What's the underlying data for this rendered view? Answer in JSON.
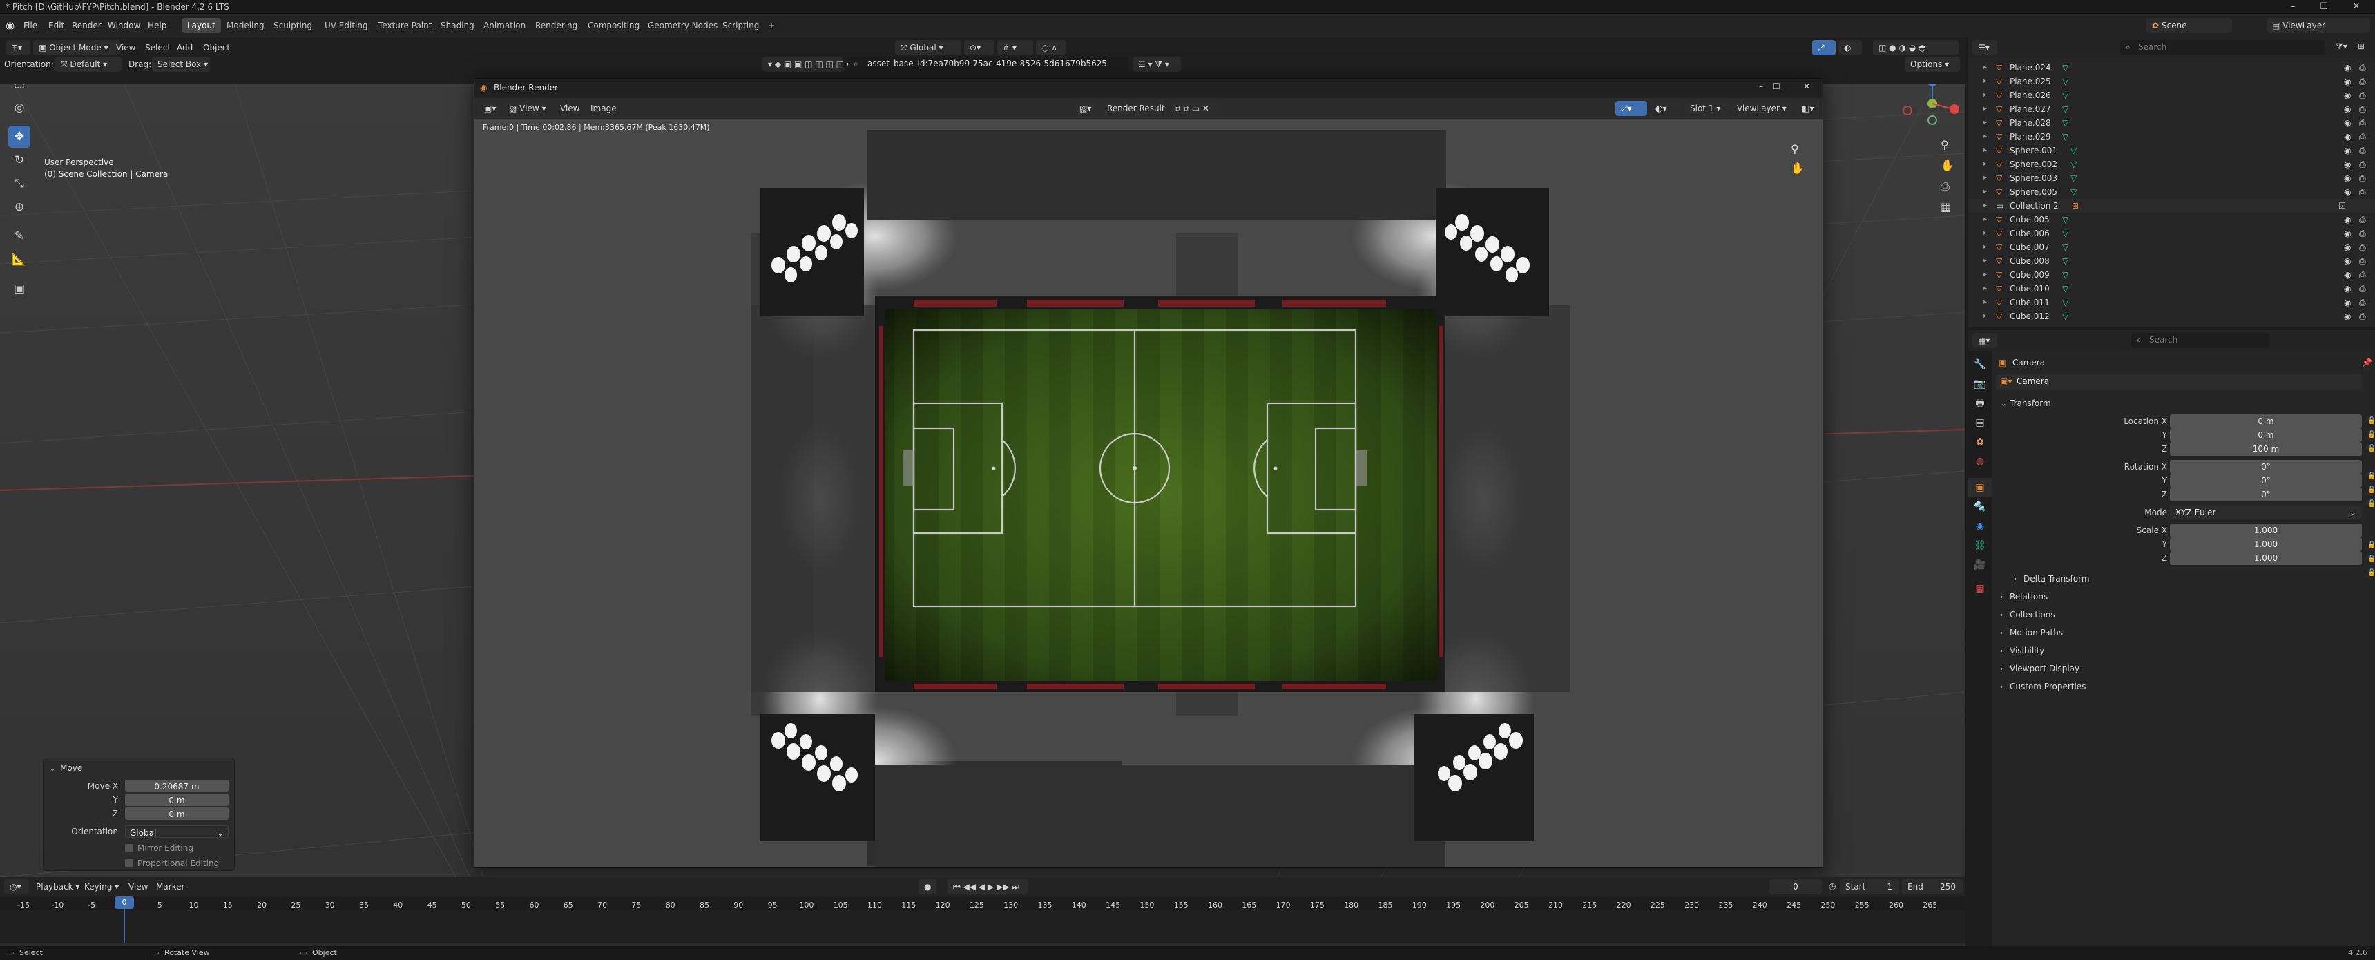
{
  "window": {
    "title": "* Pitch [D:\\GitHub\\FYP\\Pitch.blend] - Blender 4.2.6 LTS",
    "controls": [
      "–",
      "☐",
      "✕"
    ]
  },
  "menubar": {
    "menus": [
      "File",
      "Edit",
      "Render",
      "Window",
      "Help"
    ],
    "workspaces": [
      "Layout",
      "Modeling",
      "Sculpting",
      "UV Editing",
      "Texture Paint",
      "Shading",
      "Animation",
      "Rendering",
      "Compositing",
      "Geometry Nodes",
      "Scripting"
    ],
    "active_workspace": "Layout",
    "add_tab": "+",
    "scene": "Scene",
    "view_layer": "ViewLayer"
  },
  "viewport_header": {
    "mode": "Object Mode",
    "menus": [
      "View",
      "Select",
      "Add",
      "Object"
    ],
    "transform_orientation": "Global",
    "orientation_label": "Orientation:",
    "orientation_value": "Default",
    "drag_label": "Drag:",
    "drag_value": "Select Box",
    "asset_search": "asset_base_id:7ea70b99-75ac-419e-8526-5d61679b5625",
    "options": "Options"
  },
  "viewport": {
    "perspective": "User Perspective",
    "collection": "(0) Scene Collection | Camera"
  },
  "render_window": {
    "title": "Blender Render",
    "menus": [
      "View",
      "View",
      "Image"
    ],
    "image_name": "Render Result",
    "slot": "Slot 1",
    "view_layer": "ViewLayer",
    "stats": "Frame:0 | Time:00:02.86 | Mem:3365.67M (Peak 1630.47M)"
  },
  "operator_panel": {
    "title": "Move",
    "rows": [
      {
        "label": "Move X",
        "value": "0.20687 m"
      },
      {
        "label": "Y",
        "value": "0 m"
      },
      {
        "label": "Z",
        "value": "0 m"
      }
    ],
    "orientation_label": "Orientation",
    "orientation_value": "Global",
    "checks": [
      "Mirror Editing",
      "Proportional Editing"
    ]
  },
  "timeline": {
    "menus": [
      "Playback",
      "Keying",
      "View",
      "Marker"
    ],
    "current_frame": "0",
    "start_label": "Start",
    "start": "1",
    "end_label": "End",
    "end": "250",
    "ticks": [
      "-15",
      "-10",
      "-5",
      "0",
      "5",
      "10",
      "15",
      "20",
      "25",
      "30",
      "35",
      "40",
      "45",
      "50",
      "55",
      "60",
      "65",
      "70",
      "75",
      "80",
      "85",
      "90",
      "95",
      "100",
      "105",
      "110",
      "115",
      "120",
      "125",
      "130",
      "135",
      "140",
      "145",
      "150",
      "155",
      "160",
      "165",
      "170",
      "175",
      "180",
      "185",
      "190",
      "195",
      "200",
      "205",
      "210",
      "215",
      "220",
      "225",
      "230",
      "235",
      "240",
      "245",
      "250",
      "255",
      "260",
      "265"
    ]
  },
  "outliner": {
    "search_placeholder": "Search",
    "items": [
      {
        "name": "Plane.024",
        "kind": "obj"
      },
      {
        "name": "Plane.025",
        "kind": "obj"
      },
      {
        "name": "Plane.026",
        "kind": "obj"
      },
      {
        "name": "Plane.027",
        "kind": "obj"
      },
      {
        "name": "Plane.028",
        "kind": "obj"
      },
      {
        "name": "Plane.029",
        "kind": "obj"
      },
      {
        "name": "Sphere.001",
        "kind": "obj"
      },
      {
        "name": "Sphere.002",
        "kind": "obj"
      },
      {
        "name": "Sphere.003",
        "kind": "obj"
      },
      {
        "name": "Sphere.005",
        "kind": "obj"
      },
      {
        "name": "Collection 2",
        "kind": "collection"
      },
      {
        "name": "Cube.005",
        "kind": "obj"
      },
      {
        "name": "Cube.006",
        "kind": "obj"
      },
      {
        "name": "Cube.007",
        "kind": "obj"
      },
      {
        "name": "Cube.008",
        "kind": "obj"
      },
      {
        "name": "Cube.009",
        "kind": "obj"
      },
      {
        "name": "Cube.010",
        "kind": "obj"
      },
      {
        "name": "Cube.011",
        "kind": "obj"
      },
      {
        "name": "Cube.012",
        "kind": "obj"
      }
    ]
  },
  "properties": {
    "search_placeholder": "Search",
    "object_context": "Camera",
    "object_name": "Camera",
    "transform_title": "Transform",
    "location": {
      "label": "Location X",
      "x": "0 m",
      "y": "0 m",
      "z": "100 m"
    },
    "rotation": {
      "label": "Rotation X",
      "x": "0°",
      "y": "0°",
      "z": "0°"
    },
    "mode_label": "Mode",
    "mode_value": "XYZ Euler",
    "scale": {
      "label": "Scale X",
      "x": "1.000",
      "y": "1.000",
      "z": "1.000"
    },
    "axis_y": "Y",
    "axis_z": "Z",
    "delta": "Delta Transform",
    "sections": [
      "Relations",
      "Collections",
      "Motion Paths",
      "Visibility",
      "Viewport Display",
      "Custom Properties"
    ]
  },
  "statusbar": {
    "left": "Select",
    "middle": "Rotate View",
    "right_context": "Object",
    "version": "4.2.6"
  }
}
